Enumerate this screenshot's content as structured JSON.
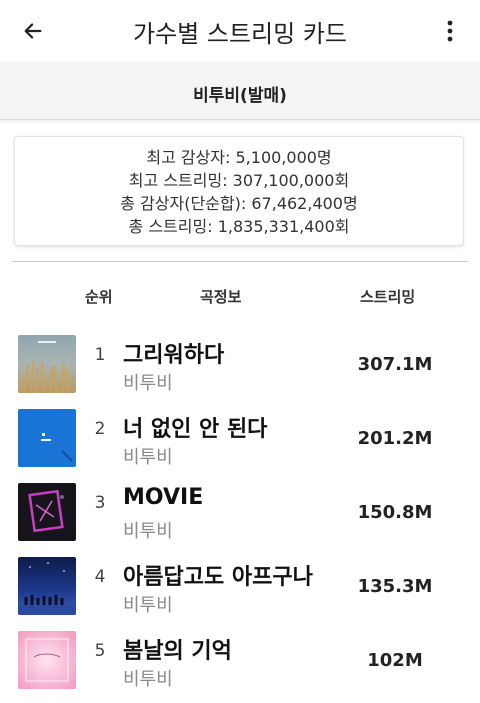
{
  "app": {
    "title": "가수별 스트리밍 카드"
  },
  "subheader": {
    "title": "비투비(발매)"
  },
  "stats": {
    "lines": [
      "최고 감상자: 5,100,000명",
      "최고 스트리밍: 307,100,000회",
      "총 감상자(단순합): 67,462,400명",
      "총 스트리밍: 1,835,331,400회"
    ]
  },
  "columns": {
    "rank": "순위",
    "info": "곡정보",
    "streams": "스트리밍"
  },
  "tracks": [
    {
      "rank": "1",
      "title": "그리워하다",
      "artist": "비투비",
      "streams": "307.1M"
    },
    {
      "rank": "2",
      "title": "너 없인 안 된다",
      "artist": "비투비",
      "streams": "201.2M"
    },
    {
      "rank": "3",
      "title": "MOVIE",
      "artist": "비투비",
      "streams": "150.8M"
    },
    {
      "rank": "4",
      "title": "아름답고도 아프구나",
      "artist": "비투비",
      "streams": "135.3M"
    },
    {
      "rank": "5",
      "title": "봄날의 기억",
      "artist": "비투비",
      "streams": "102M"
    }
  ],
  "icons": {
    "back": "arrow-left-icon",
    "more": "more-vertical-icon"
  }
}
